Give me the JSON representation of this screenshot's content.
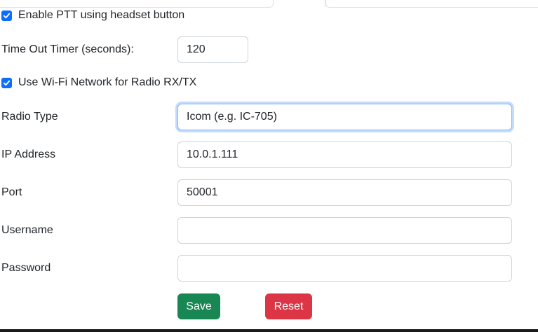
{
  "ptt": {
    "checked": true,
    "label": "Enable PTT using headset button"
  },
  "timeout": {
    "label": "Time Out Timer (seconds):",
    "value": "120"
  },
  "wifi": {
    "checked": true,
    "label": "Use Wi-Fi Network for Radio RX/TX"
  },
  "radio_type": {
    "label": "Radio Type",
    "value": "Icom (e.g. IC-705)"
  },
  "ip_address": {
    "label": "IP Address",
    "value": "10.0.1.111"
  },
  "port": {
    "label": "Port",
    "value": "50001"
  },
  "username": {
    "label": "Username",
    "value": ""
  },
  "password": {
    "label": "Password",
    "value": ""
  },
  "buttons": {
    "save_label": "Save",
    "reset_label": "Reset"
  },
  "colors": {
    "checkbox": "#0d6efd",
    "save": "#198754",
    "reset": "#dc3545",
    "focus_border": "#86b7fe"
  }
}
